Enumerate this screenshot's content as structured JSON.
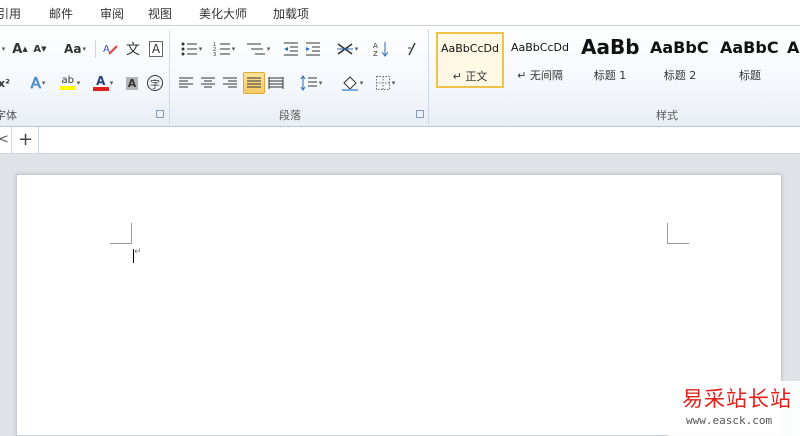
{
  "menu_tabs": [
    "引用",
    "邮件",
    "审阅",
    "视图",
    "美化大师",
    "加载项"
  ],
  "ribbon": {
    "groups": {
      "font_label": "字体",
      "paragraph_label": "段落",
      "styles_label": "样式"
    },
    "font": {
      "grow_font": "A",
      "shrink_font": "A",
      "change_case": "Aa",
      "phonetic": "文",
      "enclose_border": "A",
      "superscript": "x²",
      "text_effect": "A",
      "highlight": "ab",
      "font_color": "A",
      "char_shading": "A",
      "enclose_char": "字"
    },
    "styles": [
      {
        "sample": "AaBbCcDd",
        "name": "↵ 正文",
        "selected": true
      },
      {
        "sample": "AaBbCcDd",
        "name": "↵ 无间隔",
        "selected": false
      },
      {
        "sample": "AaBb",
        "name": "标题 1",
        "selected": false
      },
      {
        "sample": "AaBbC",
        "name": "标题 2",
        "selected": false
      },
      {
        "sample": "AaBbC",
        "name": "标题",
        "selected": false
      },
      {
        "sample": "A",
        "name": "",
        "selected": false
      }
    ]
  },
  "doc_tabs": {
    "prev": "<",
    "add": "+"
  },
  "document": {
    "paragraph_mark": "↵"
  },
  "watermark": {
    "title": "易采站长站",
    "url": "www.easck.com"
  },
  "colors": {
    "accent_red": "#e0211b",
    "highlight_yellow": "#ffff00",
    "selected_border": "#f0c24a"
  }
}
